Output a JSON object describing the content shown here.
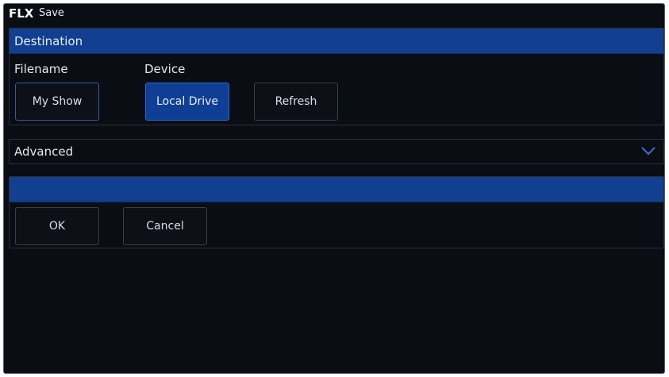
{
  "titlebar": {
    "logo": "FLX",
    "title": "Save"
  },
  "destination": {
    "header": "Destination",
    "filename_label": "Filename",
    "device_label": "Device",
    "filename_button": "My Show",
    "device_button": "Local Drive",
    "refresh_button": "Refresh"
  },
  "advanced": {
    "label": "Advanced",
    "expand_icon": "chevron-down-icon"
  },
  "actions": {
    "header": "",
    "ok_label": "OK",
    "cancel_label": "Cancel"
  },
  "colors": {
    "accent_blue": "#123f8f",
    "background": "#0b0d14",
    "text": "#e6e9ef"
  }
}
